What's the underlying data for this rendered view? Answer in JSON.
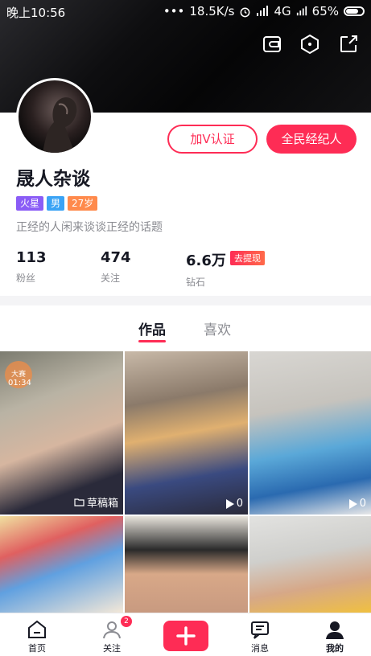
{
  "status_bar": {
    "time": "晚上10:56",
    "dots": "•••",
    "speed": "18.5K/s",
    "network": "4G",
    "battery": "65%"
  },
  "header_icons": [
    "wallet-icon",
    "settings-icon",
    "share-icon"
  ],
  "profile": {
    "name": "晟人杂谈",
    "verify_button": "加V认证",
    "agent_button": "全民经纪人",
    "tags": [
      {
        "text": "火星",
        "color": "#8a5cf6"
      },
      {
        "text": "男",
        "color": "#3aa3f5"
      },
      {
        "text": "27岁",
        "color": "#ff8a4c"
      }
    ],
    "bio": "正经的人闲来谈谈正经的话题"
  },
  "stats": [
    {
      "value": "113",
      "label": "粉丝"
    },
    {
      "value": "474",
      "label": "关注"
    },
    {
      "value": "6.6万",
      "label": "钻石"
    }
  ],
  "withdraw_label": "去提现",
  "tabs": [
    {
      "label": "作品",
      "active": true
    },
    {
      "label": "喜欢",
      "active": false
    }
  ],
  "grid": [
    {
      "overlay": "草稿箱",
      "badge": "大赛",
      "duration": "01:34"
    },
    {
      "overlay": "0"
    },
    {
      "overlay": "0"
    },
    {
      "overlay": ""
    },
    {
      "overlay": ""
    },
    {
      "overlay": ""
    }
  ],
  "bottom_nav": [
    {
      "label": "首页",
      "icon": "home-icon"
    },
    {
      "label": "关注",
      "icon": "follow-icon",
      "badge": "2"
    },
    {
      "label": "",
      "icon": "plus-icon"
    },
    {
      "label": "消息",
      "icon": "message-icon"
    },
    {
      "label": "我的",
      "icon": "me-icon"
    }
  ],
  "colors": {
    "accent": "#fe2c55"
  }
}
